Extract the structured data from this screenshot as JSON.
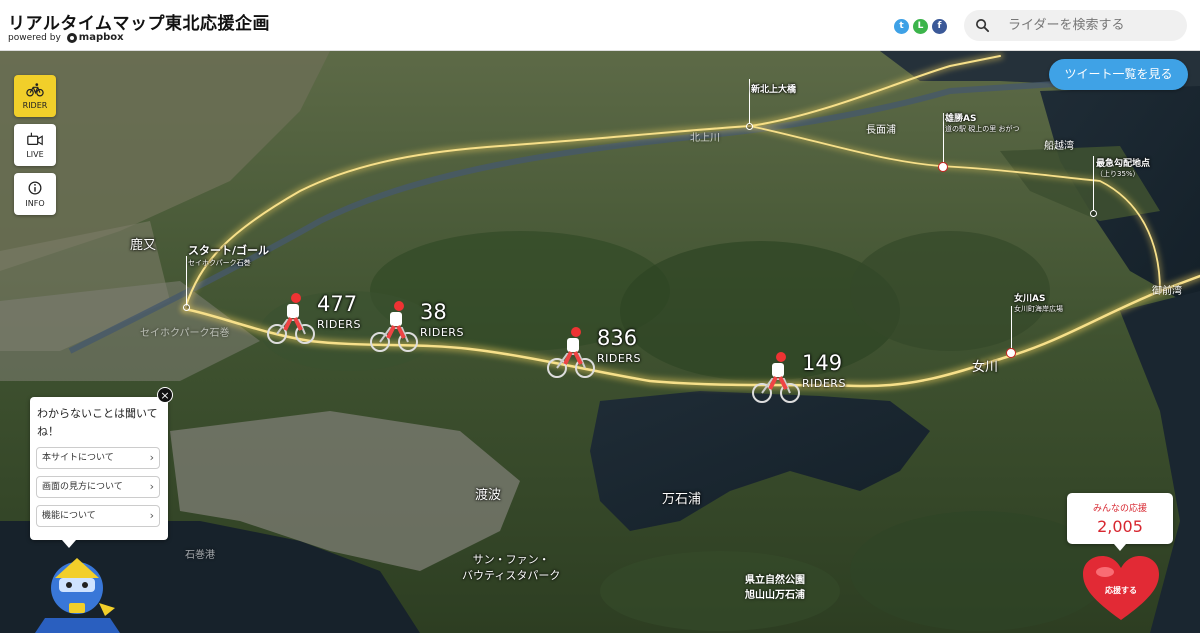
{
  "header": {
    "title": "リアルタイムマップ東北応援企画",
    "powered_by": "powered by",
    "mapbox_logo": "mapbox",
    "social": {
      "twitter": "t",
      "line": "L",
      "facebook": "f"
    },
    "search_placeholder": "ライダーを検索する"
  },
  "nav": [
    {
      "label": "RIDER",
      "icon": "bicycle-icon",
      "active": true
    },
    {
      "label": "LIVE",
      "icon": "camera-icon",
      "active": false
    },
    {
      "label": "INFO",
      "icon": "info-icon",
      "active": false
    }
  ],
  "tweet_button": "ツイート一覧を見る",
  "map": {
    "pois": [
      {
        "name": "スタート/ゴール",
        "sub": "セイホクパーク石巻"
      },
      {
        "name": "新北上大橋",
        "sub": ""
      },
      {
        "name": "雄勝AS",
        "sub": "道の駅 硯上の里 おがつ"
      },
      {
        "name": "最急勾配地点",
        "sub": "（上り35%）"
      },
      {
        "name": "女川AS",
        "sub": "女川町海岸広場"
      }
    ],
    "places": {
      "hebita": "鹿又",
      "watanoha": "渡波",
      "mangokuura": "万石浦",
      "onagawa": "女川",
      "sunfan": "サン・ファン・\nバウティスタパーク",
      "nagatsura": "長面浦",
      "funakoshi": "船越湾",
      "onagawawan": "御前湾",
      "kitakami": "北上川",
      "ishinomaki_port": "石巻港",
      "prefpark": "県立自然公園\n旭山山万石浦",
      "seihoku_faded": "セイホクパーク石巻"
    },
    "clusters": [
      {
        "count": "477",
        "unit": "RIDERS"
      },
      {
        "count": "38",
        "unit": "RIDERS"
      },
      {
        "count": "836",
        "unit": "RIDERS"
      },
      {
        "count": "149",
        "unit": "RIDERS"
      }
    ]
  },
  "help": {
    "message": "わからないことは聞いてね！",
    "items": [
      "本サイトについて",
      "画面の見方について",
      "機能について"
    ],
    "close": "×"
  },
  "support": {
    "label": "みんなの応援",
    "count": "2,005",
    "button": "応援する"
  },
  "colors": {
    "accent_yellow": "#f1cf2a",
    "tweet_blue": "#3fa2e6",
    "support_red": "#d7262f",
    "route_glow": "#f4d35e"
  }
}
